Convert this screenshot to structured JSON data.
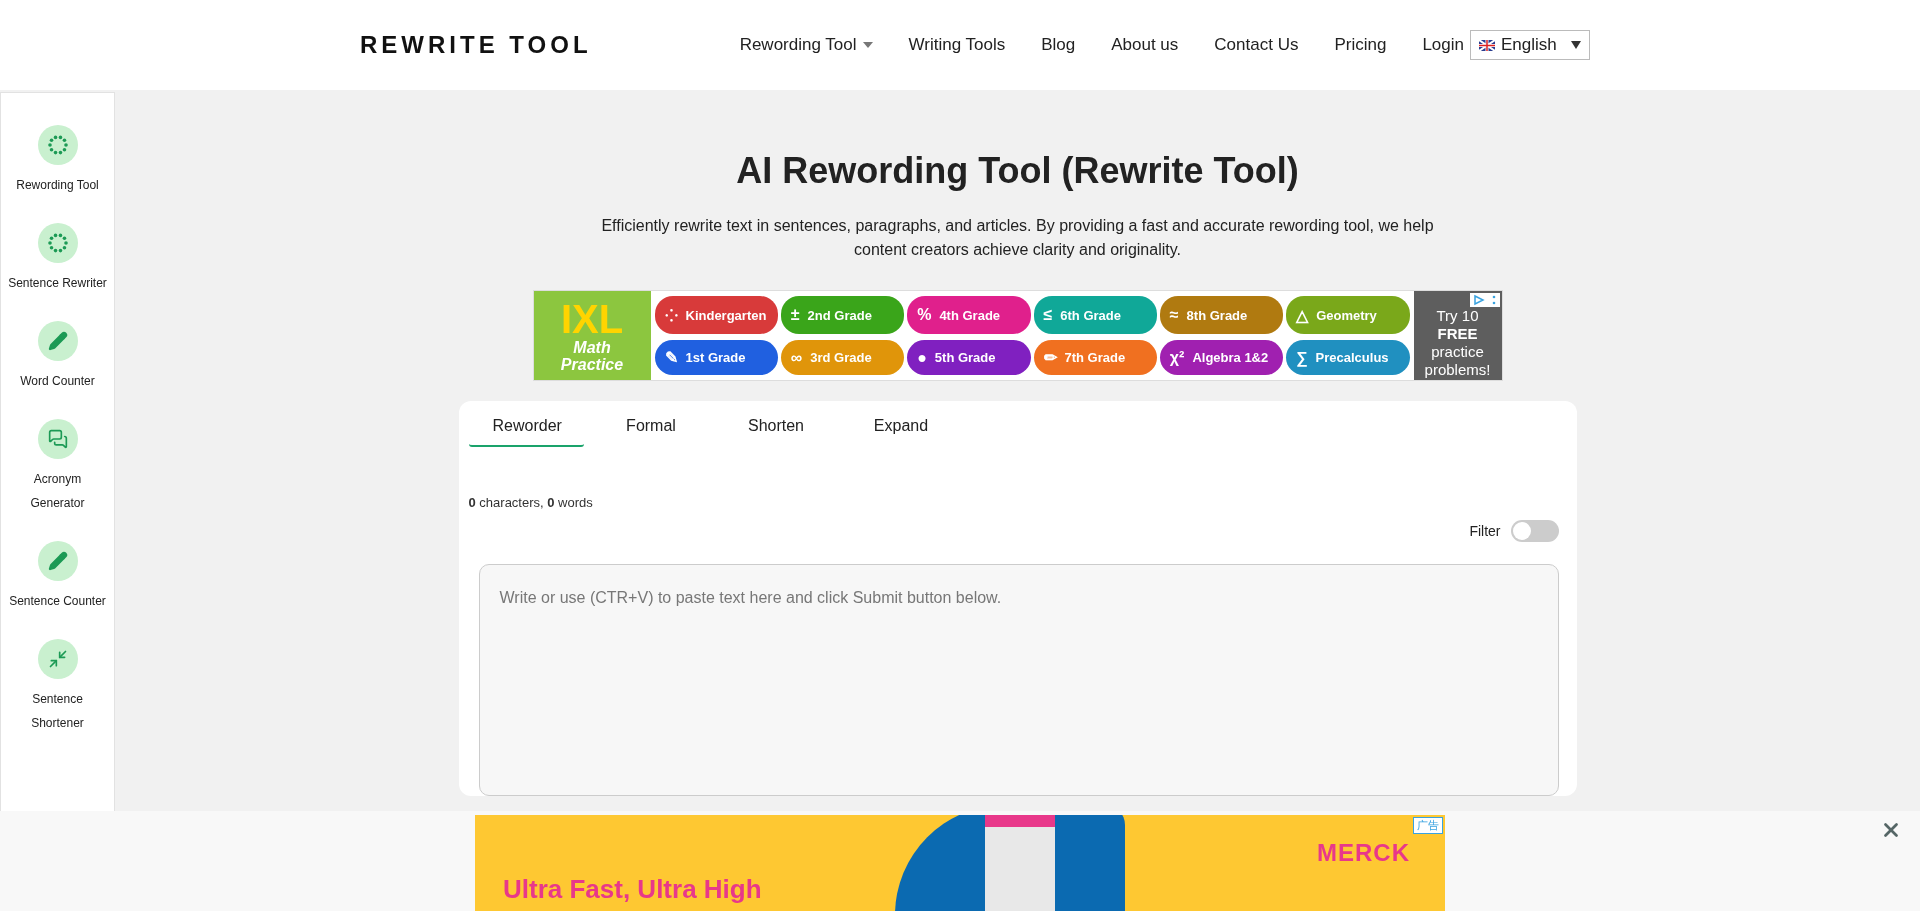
{
  "header": {
    "logo": "REWRITE TOOL",
    "nav": [
      {
        "label": "Rewording Tool",
        "dropdown": true
      },
      {
        "label": "Writing Tools",
        "dropdown": false
      },
      {
        "label": "Blog",
        "dropdown": false
      },
      {
        "label": "About us",
        "dropdown": false
      },
      {
        "label": "Contact Us",
        "dropdown": false
      },
      {
        "label": "Pricing",
        "dropdown": false
      },
      {
        "label": "Login",
        "dropdown": false
      }
    ],
    "language": "English"
  },
  "sidebar": {
    "items": [
      {
        "label": "Rewording Tool",
        "kind": "dots"
      },
      {
        "label": "Sentence Rewriter",
        "kind": "dots"
      },
      {
        "label": "Word Counter",
        "kind": "pencil"
      },
      {
        "label": "Acronym Generator",
        "kind": "chat"
      },
      {
        "label": "Sentence Counter",
        "kind": "pencil"
      },
      {
        "label": "Sentence Shortener",
        "kind": "shrink"
      }
    ]
  },
  "hero": {
    "title": "AI Rewording Tool (Rewrite Tool)",
    "subtitle": "Efficiently rewrite text in sentences, paragraphs, and articles. By providing a fast and accurate rewording tool, we help content creators achieve clarity and originality."
  },
  "top_ad": {
    "brand": "IXL",
    "brand_caption": "Math Practice",
    "pills": [
      {
        "symbol": "⁘",
        "label": "Kindergarten",
        "color": "#d83a3a"
      },
      {
        "symbol": "±",
        "label": "2nd Grade",
        "color": "#3aa51a"
      },
      {
        "symbol": "%",
        "label": "4th Grade",
        "color": "#e0208c"
      },
      {
        "symbol": "≤",
        "label": "6th Grade",
        "color": "#10a898"
      },
      {
        "symbol": "≈",
        "label": "8th Grade",
        "color": "#b07a10"
      },
      {
        "symbol": "△",
        "label": "Geometry",
        "color": "#7aa81a"
      },
      {
        "symbol": "✎",
        "label": "1st Grade",
        "color": "#2060e0"
      },
      {
        "symbol": "∞",
        "label": "3rd Grade",
        "color": "#e0950a"
      },
      {
        "symbol": "●",
        "label": "5th Grade",
        "color": "#8020c0"
      },
      {
        "symbol": "✏",
        "label": "7th Grade",
        "color": "#f07020"
      },
      {
        "symbol": "χ²",
        "label": "Algebra 1&2",
        "color": "#a020b0"
      },
      {
        "symbol": "∑",
        "label": "Precalculus",
        "color": "#2090c0"
      }
    ],
    "cta": [
      "Try 10",
      "FREE",
      "practice",
      "problems!"
    ]
  },
  "editor": {
    "tabs": [
      {
        "label": "Reworder",
        "selected": true
      },
      {
        "label": "Formal",
        "selected": false
      },
      {
        "label": "Shorten",
        "selected": false
      },
      {
        "label": "Expand",
        "selected": false
      }
    ],
    "counter": "**0** characters,  **0** words",
    "filter": {
      "label": "Filter",
      "on": false
    },
    "placeholder": "Write or use (CTR+V) to paste text here and click Submit button below."
  },
  "bottom_ad": {
    "label": "广告",
    "headline": "Ultra Fast, Ultra High",
    "brand": "MERCK"
  }
}
